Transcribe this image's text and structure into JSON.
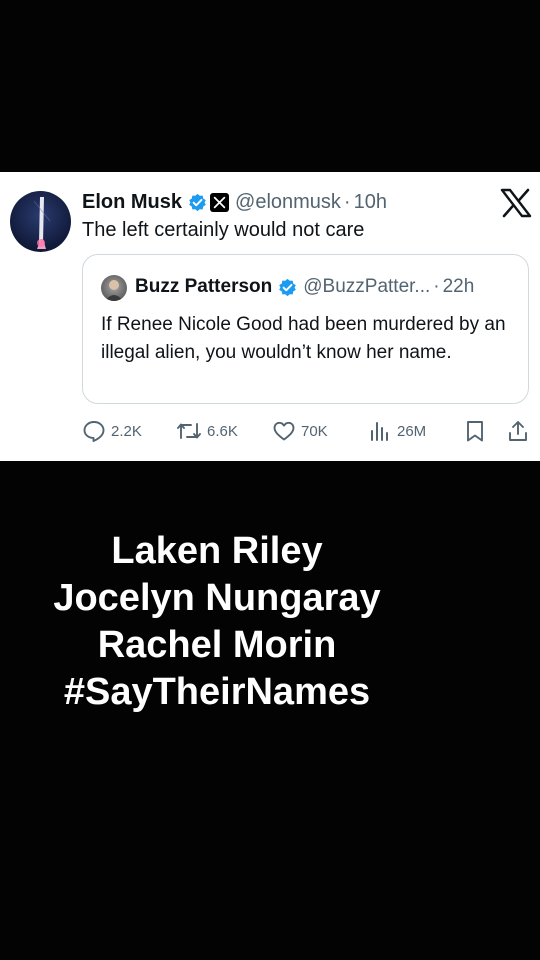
{
  "tweet": {
    "author_name": "Elon Musk",
    "handle": "@elonmusk",
    "separator": "·",
    "time": "10h",
    "text": "The left certainly would not care",
    "avatar_icon": "rocket-launch-avatar",
    "quoted": {
      "author_name": "Buzz Patterson",
      "handle": "@BuzzPatter...",
      "separator": "·",
      "time": "22h",
      "text": "If Renee Nicole Good had been murdered by an illegal alien, you wouldn’t know her name."
    },
    "metrics": {
      "replies": "2.2K",
      "reposts": "6.6K",
      "likes": "70K",
      "views": "26M"
    }
  },
  "overlay": {
    "lines": [
      "Laken Riley",
      "Jocelyn Nungaray",
      "Rachel Morin",
      "#SayTheirNames"
    ]
  },
  "colors": {
    "background": "#030303",
    "card": "#ffffff",
    "text": "#0f1419",
    "muted": "#536471",
    "verified": "#1d9bf0"
  }
}
